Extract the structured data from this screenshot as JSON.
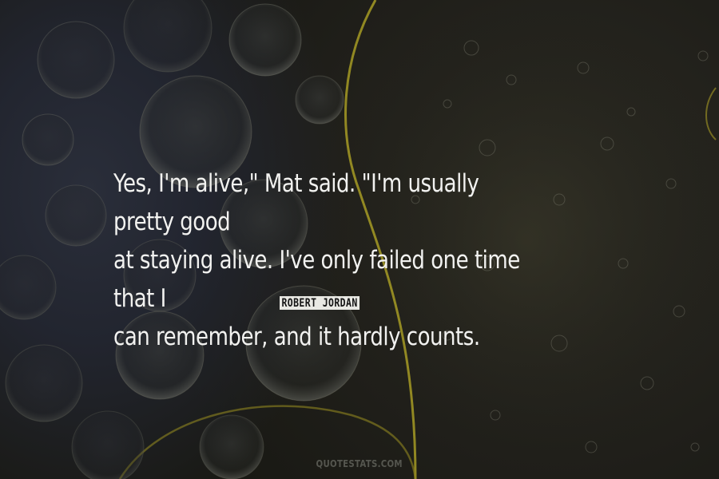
{
  "quote": {
    "lines": [
      "Yes, I'm alive,\" Mat said. \"I'm usually pretty good",
      "at staying alive. I've only failed one time that I",
      "can remember, and it hardly counts."
    ]
  },
  "author": {
    "name": "ROBERT JORDAN"
  },
  "footer": {
    "site": "QUOTESTATS.COM"
  },
  "colors": {
    "text": "#f2f2f0",
    "accent_curve": "#b3a82a",
    "background": "#1e1e1b"
  }
}
